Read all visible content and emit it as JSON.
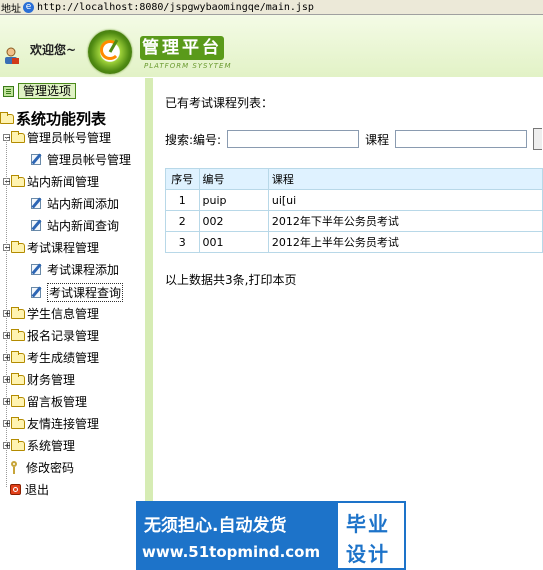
{
  "address_bar": {
    "label": "地址",
    "url": "http://localhost:8080/jspgwybaomingqe/main.jsp"
  },
  "header": {
    "welcome": "欢迎您~",
    "brand": "管理平台",
    "brand_sub": "PLATFORM SYSYTEM"
  },
  "sidebar": {
    "manage_button": "管理选项",
    "root": "系统功能列表",
    "groups": [
      {
        "label": "管理员帐号管理",
        "expanded": true,
        "children": [
          "管理员帐号管理"
        ]
      },
      {
        "label": "站内新闻管理",
        "expanded": true,
        "children": [
          "站内新闻添加",
          "站内新闻查询"
        ]
      },
      {
        "label": "考试课程管理",
        "expanded": true,
        "children": [
          "考试课程添加",
          "考试课程查询"
        ]
      },
      {
        "label": "学生信息管理",
        "expanded": false
      },
      {
        "label": "报名记录管理",
        "expanded": false
      },
      {
        "label": "考生成绩管理",
        "expanded": false
      },
      {
        "label": "财务管理",
        "expanded": false
      },
      {
        "label": "留言板管理",
        "expanded": false
      },
      {
        "label": "友情连接管理",
        "expanded": false
      },
      {
        "label": "系统管理",
        "expanded": false
      }
    ],
    "change_password": "修改密码",
    "logout": "退出"
  },
  "main": {
    "heading": "已有考试课程列表：",
    "search": {
      "label_id": "搜索:编号:",
      "value_id": "",
      "label_course": "课程",
      "value_course": ""
    },
    "table": {
      "headers": [
        "序号",
        "编号",
        "课程"
      ],
      "rows": [
        [
          "1",
          "puip",
          "ui[ui"
        ],
        [
          "2",
          "002",
          "2012年下半年公务员考试"
        ],
        [
          "3",
          "001",
          "2012年上半年公务员考试"
        ]
      ]
    },
    "summary": "以上数据共3条,打印本页"
  },
  "watermark": {
    "line1": "无须担心.自动发货",
    "line2": "www.51topmind.com",
    "right1": "毕业",
    "right2": "设计"
  },
  "colors": {
    "sidebar_border": "#d6ecb4",
    "header_bg": "#e2f2c6",
    "brand_bg": "#5a9a1a",
    "table_header_bg": "#dff2ff",
    "watermark_blue": "#1d73c9"
  }
}
